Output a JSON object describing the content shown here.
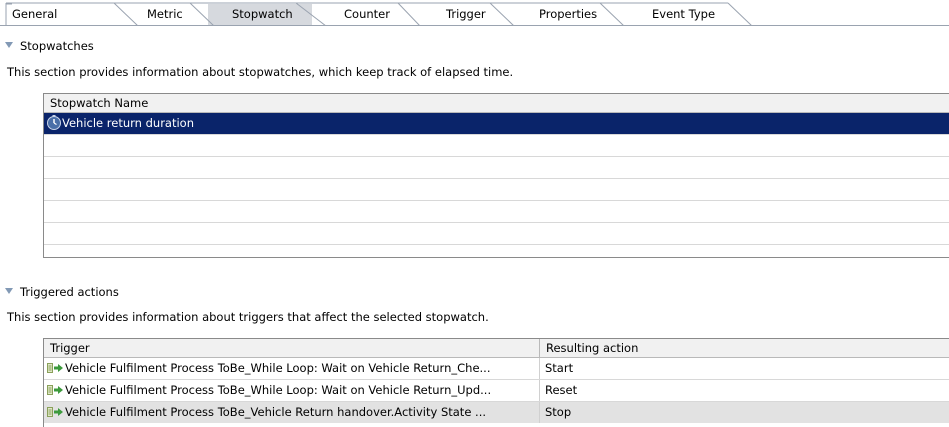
{
  "tabs": [
    {
      "label": "General",
      "active": false
    },
    {
      "label": "Metric",
      "active": false
    },
    {
      "label": "Stopwatch",
      "active": true
    },
    {
      "label": "Counter",
      "active": false
    },
    {
      "label": "Trigger",
      "active": false
    },
    {
      "label": "Properties",
      "active": false
    },
    {
      "label": "Event Type",
      "active": false
    }
  ],
  "stopwatches": {
    "heading": "Stopwatches",
    "description": "This section provides information about stopwatches, which keep track of elapsed time.",
    "column_header": "Stopwatch Name",
    "rows": [
      {
        "name": "Vehicle return duration",
        "icon": "stopwatch-icon",
        "selected": true
      }
    ]
  },
  "triggered_actions": {
    "heading": "Triggered actions",
    "description": "This section provides information about triggers that affect the selected stopwatch.",
    "columns": [
      "Trigger",
      "Resulting action"
    ],
    "rows": [
      {
        "trigger": "Vehicle Fulfilment Process ToBe_While Loop: Wait on Vehicle Return_Che...",
        "action": "Start",
        "icon": "trigger-arrow-icon"
      },
      {
        "trigger": "Vehicle Fulfilment Process ToBe_While Loop: Wait on Vehicle Return_Upd...",
        "action": "Reset",
        "icon": "trigger-arrow-icon"
      },
      {
        "trigger": "Vehicle Fulfilment Process ToBe_Vehicle Return handover.Activity State ...",
        "action": "Stop",
        "icon": "trigger-arrow-icon"
      }
    ]
  },
  "colors": {
    "selection": "#0a246a",
    "active_tab": "#d6d9de",
    "twisty": "#8299b5"
  }
}
